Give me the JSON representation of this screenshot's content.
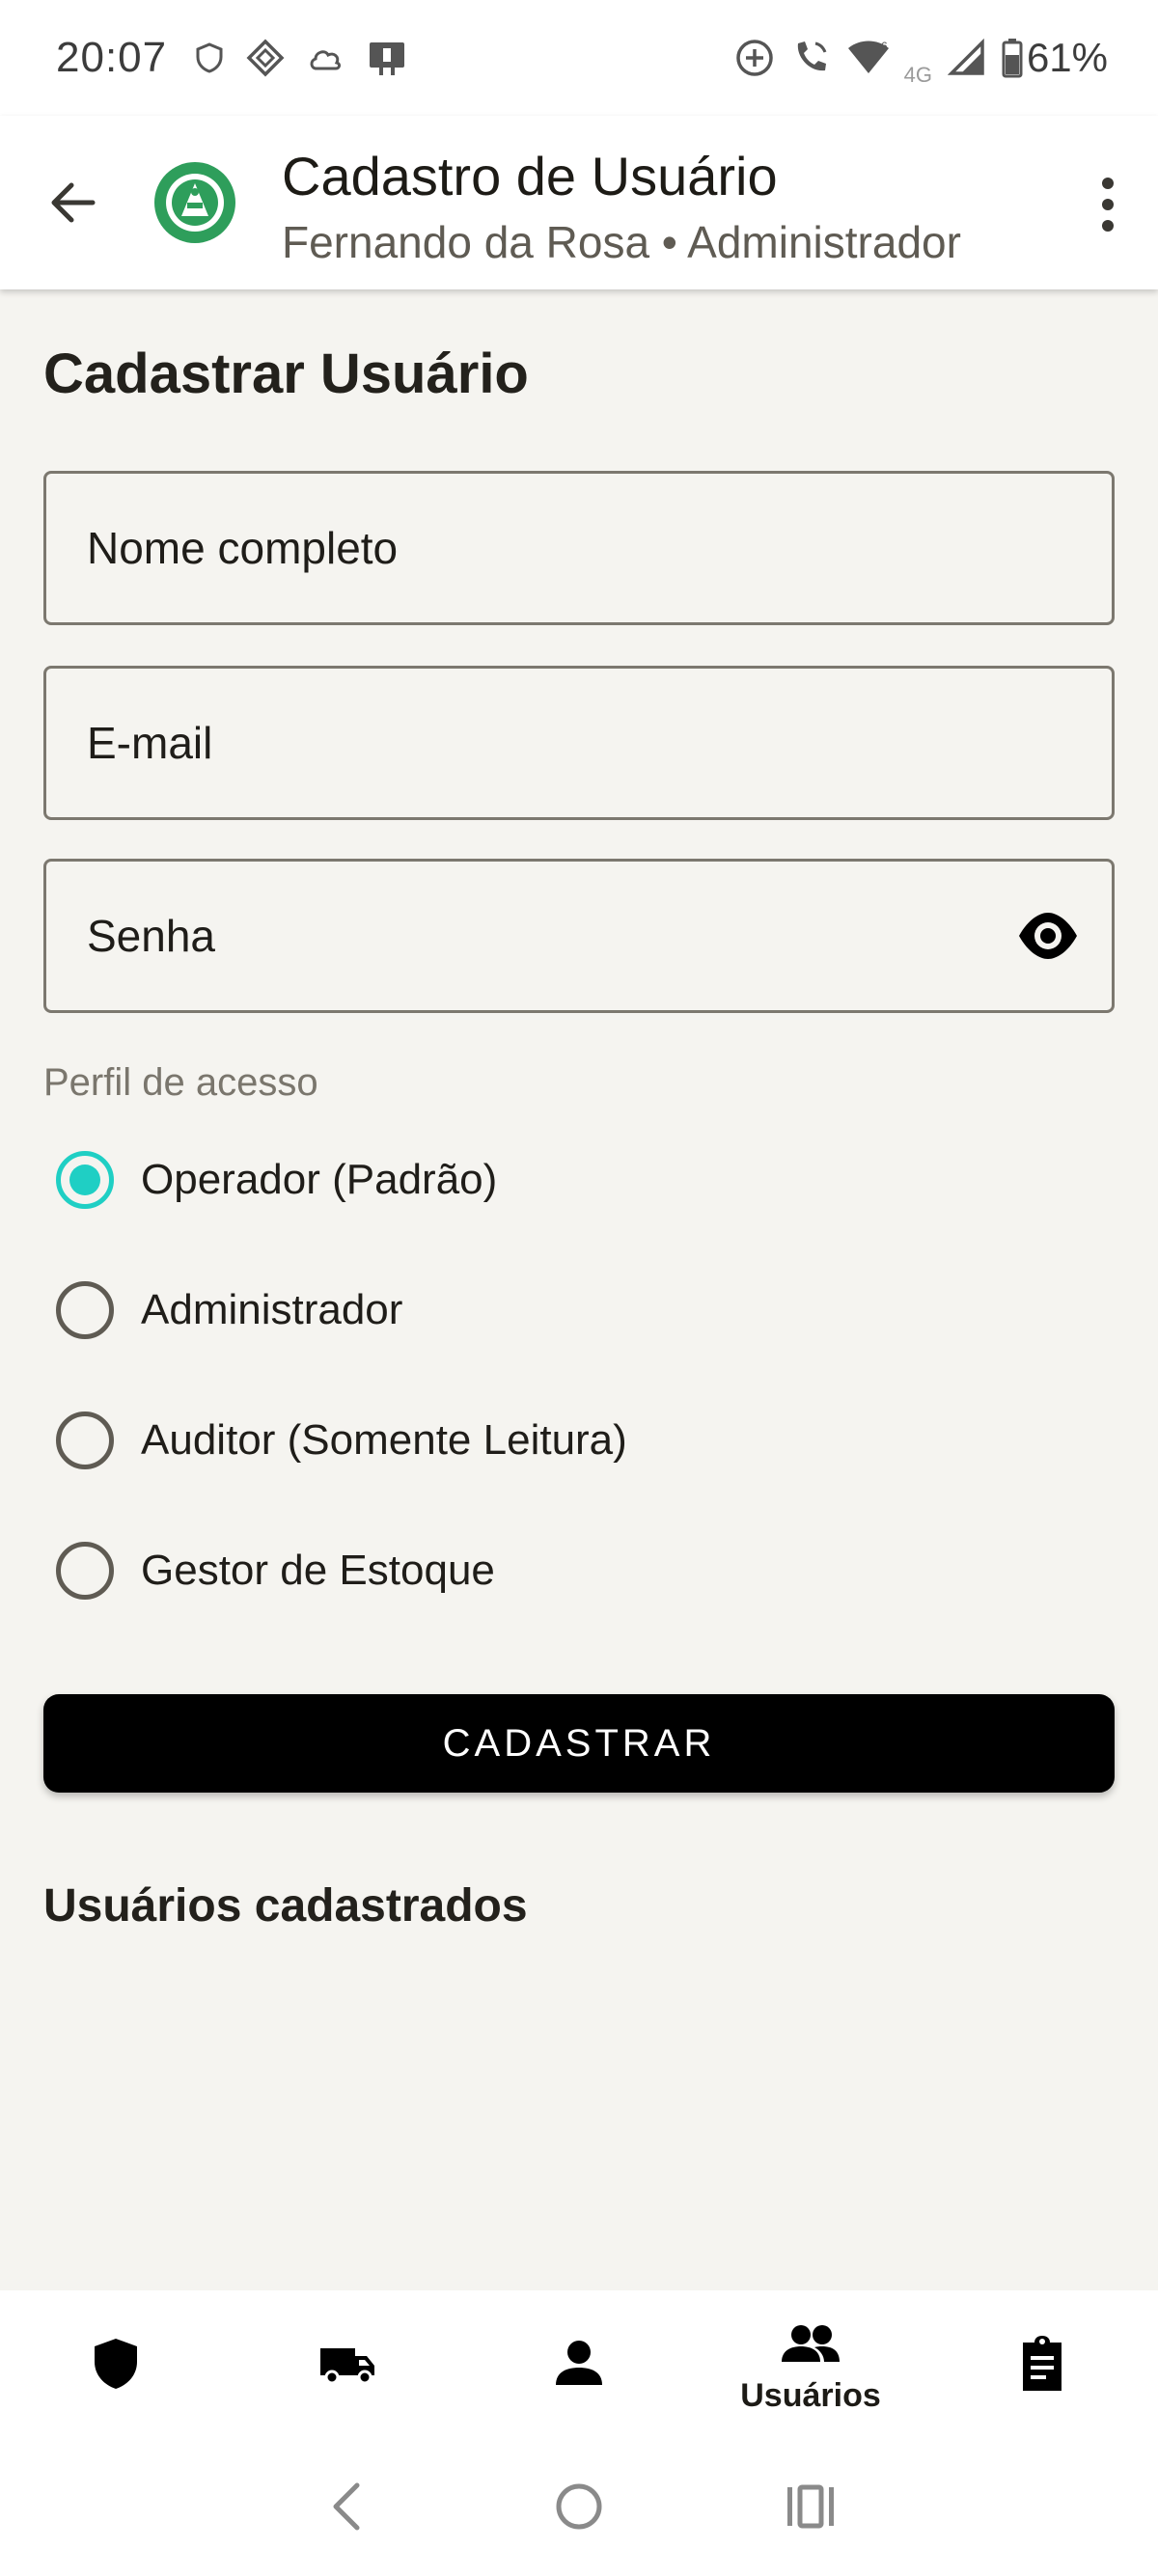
{
  "status_bar": {
    "time": "20:07",
    "network": "4G",
    "battery": "61%"
  },
  "app_bar": {
    "title": "Cadastro de Usuário",
    "subtitle": "Fernando da Rosa • Administrador"
  },
  "form": {
    "title": "Cadastrar Usuário",
    "name_label": "Nome completo",
    "email_label": "E-mail",
    "password_label": "Senha",
    "role_heading": "Perfil de acesso",
    "roles": [
      {
        "label": "Operador (Padrão)",
        "selected": true
      },
      {
        "label": "Administrador",
        "selected": false
      },
      {
        "label": "Auditor (Somente Leitura)",
        "selected": false
      },
      {
        "label": "Gestor de Estoque",
        "selected": false
      }
    ],
    "submit_label": "CADASTRAR"
  },
  "list": {
    "title": "Usuários cadastrados"
  },
  "bottom_nav": {
    "items": [
      {
        "icon": "shield-icon",
        "label": ""
      },
      {
        "icon": "truck-icon",
        "label": ""
      },
      {
        "icon": "person-icon",
        "label": ""
      },
      {
        "icon": "people-icon",
        "label": "Usuários"
      },
      {
        "icon": "clipboard-icon",
        "label": ""
      }
    ],
    "active_index": 3
  },
  "colors": {
    "accent": "#1fcfc4",
    "brand_green": "#2e9e5b",
    "background": "#f5f4f0",
    "button": "#000000"
  }
}
